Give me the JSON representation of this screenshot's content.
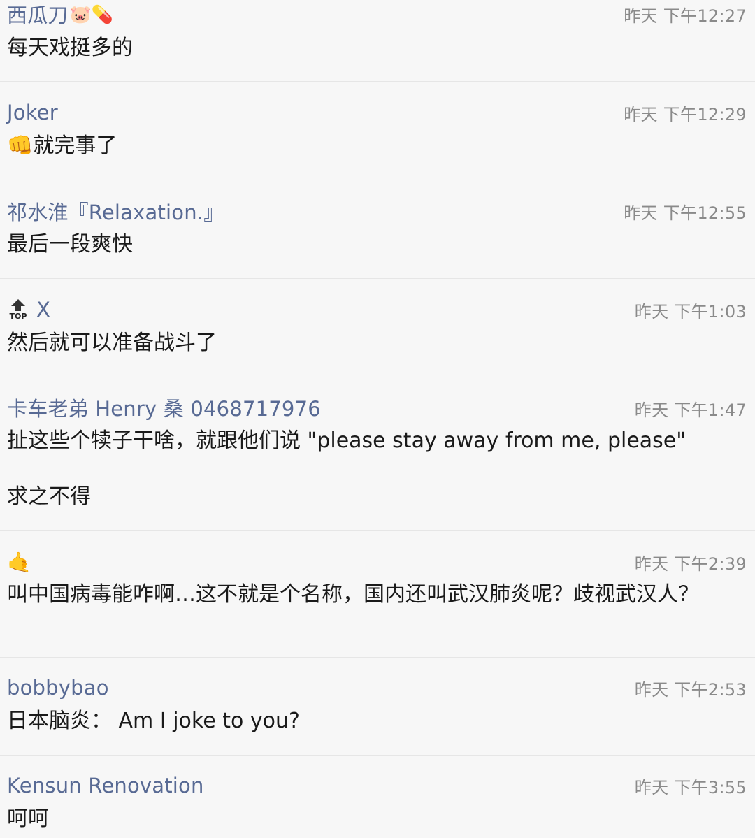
{
  "comments": [
    {
      "name": "西瓜刀",
      "emoji": "🐷💊",
      "time": "昨天 下午12:27",
      "text": "每天戏挺多的"
    },
    {
      "name": "Joker",
      "emoji": "",
      "time": "昨天 下午12:29",
      "text_emoji": "👊",
      "text": "就完事了"
    },
    {
      "name": "祁水淮『Relaxation.』",
      "emoji": "",
      "time": "昨天 下午12:55",
      "text": "最后一段爽快"
    },
    {
      "name": "X",
      "badge_label": "TOP",
      "time": "昨天 下午1:03",
      "text": "然后就可以准备战斗了"
    },
    {
      "name": "卡车老弟 Henry 桑 0468717976",
      "emoji": "",
      "time": "昨天 下午1:47",
      "text": "扯这些个犊子干啥，就跟他们说 \"please stay away from me, please\"\n\n求之不得"
    },
    {
      "name_emoji": "🤙",
      "time": "昨天 下午2:39",
      "text": "叫中国病毒能咋啊…这不就是个名称，国内还叫武汉肺炎呢？歧视武汉人？"
    },
    {
      "name": "bobbybao",
      "emoji": "",
      "time": "昨天 下午2:53",
      "text": "日本脑炎： Am I joke to you?"
    },
    {
      "name": "Kensun Renovation",
      "emoji": "",
      "time": "昨天 下午3:55",
      "text": "呵呵"
    }
  ]
}
